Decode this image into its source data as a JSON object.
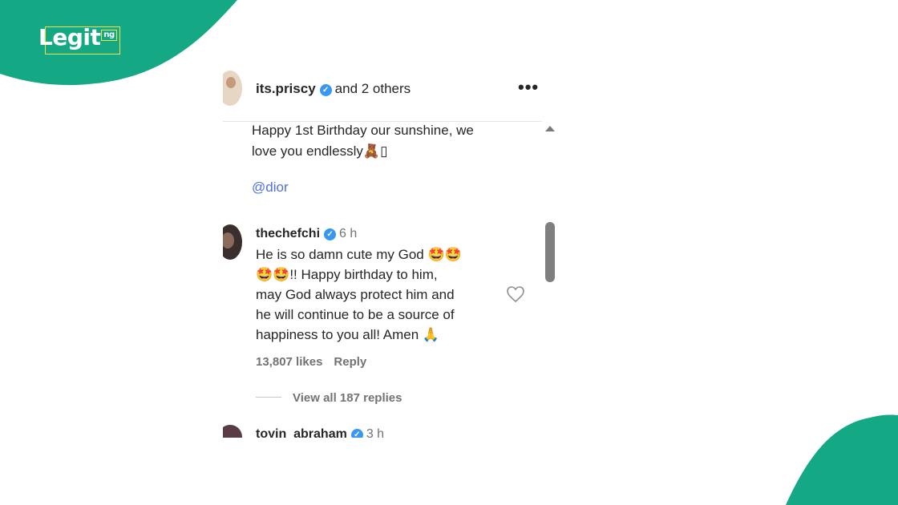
{
  "brand": {
    "logo_text": "Legit",
    "logo_suffix": "ng",
    "accent": "#14a884"
  },
  "post": {
    "author": "its.priscy",
    "others": "and 2 others",
    "caption_line1": "Happy 1st Birthday our sunshine, we",
    "caption_line2": "love you endlessly🧸▯",
    "mention": "@dior"
  },
  "comments": [
    {
      "user": "thechefchi",
      "time": "6 h",
      "line1": "He is so damn cute my God 🤩🤩",
      "line2": "🤩🤩!! Happy birthday to him,",
      "line3": "may God always protect him and",
      "line4": "he will continue to be a source of",
      "line5": "happiness to you all! Amen 🙏",
      "likes": "13,807 likes",
      "reply_label": "Reply",
      "view_replies": "View all 187 replies"
    },
    {
      "user": "toyin_abraham",
      "time": "3 h"
    }
  ],
  "icons": {
    "verified": "verified-badge-icon",
    "more": "more-options-icon",
    "like": "heart-icon"
  }
}
